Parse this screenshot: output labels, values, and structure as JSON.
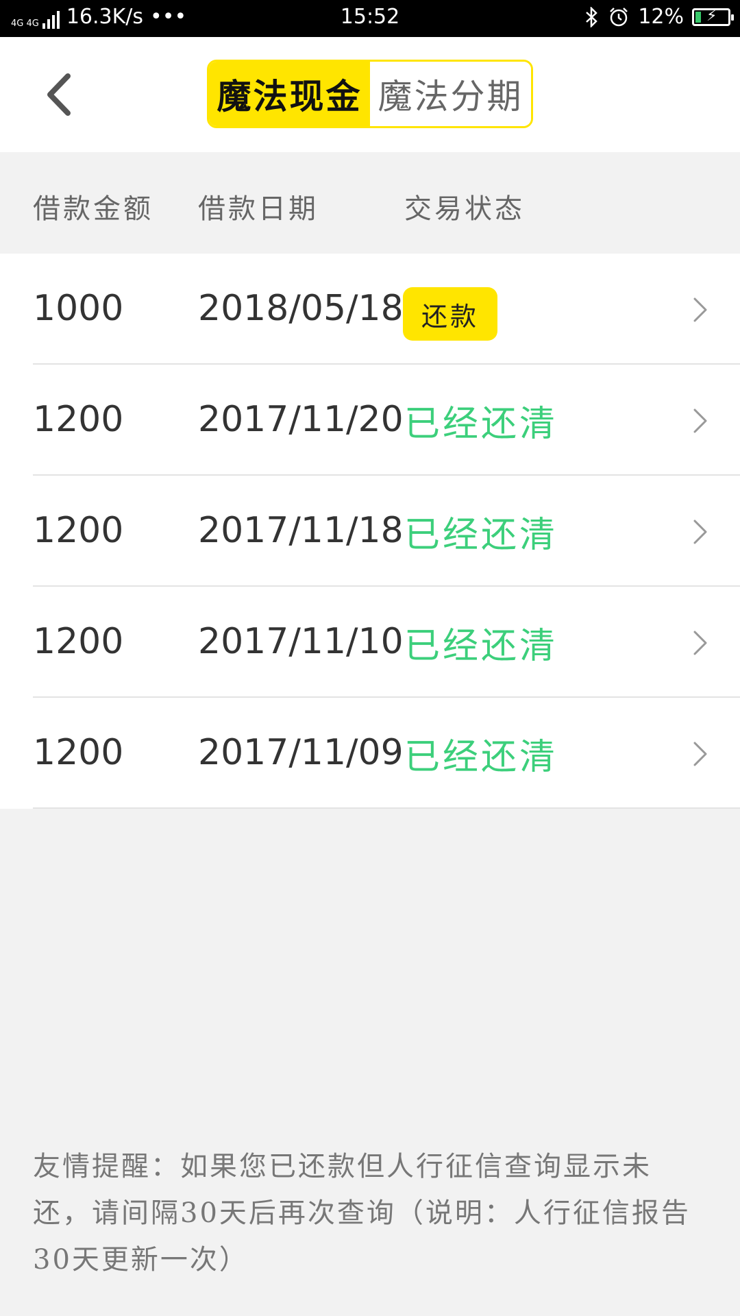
{
  "status_bar": {
    "network": "4G 4G",
    "speed": "16.3K/s",
    "dots": "•••",
    "time": "15:52",
    "battery": "12%"
  },
  "header": {
    "tabs": [
      {
        "label": "魔法现金",
        "active": true
      },
      {
        "label": "魔法分期",
        "active": false
      }
    ]
  },
  "table": {
    "columns": [
      "借款金额",
      "借款日期",
      "交易状态"
    ],
    "rows": [
      {
        "amount": "1000",
        "date": "2018/05/18",
        "status": "还款",
        "status_type": "action"
      },
      {
        "amount": "1200",
        "date": "2017/11/20",
        "status": "已经还清",
        "status_type": "done"
      },
      {
        "amount": "1200",
        "date": "2017/11/18",
        "status": "已经还清",
        "status_type": "done"
      },
      {
        "amount": "1200",
        "date": "2017/11/10",
        "status": "已经还清",
        "status_type": "done"
      },
      {
        "amount": "1200",
        "date": "2017/11/09",
        "status": "已经还清",
        "status_type": "done"
      }
    ]
  },
  "notice": "友情提醒：如果您已还款但人行征信查询显示未还，请间隔30天后再次查询（说明：人行征信报告30天更新一次）",
  "colors": {
    "accent": "#ffe500",
    "done": "#3ccf7b"
  },
  "icons": {
    "back": "chevron-left-icon",
    "row": "chevron-right-icon"
  }
}
